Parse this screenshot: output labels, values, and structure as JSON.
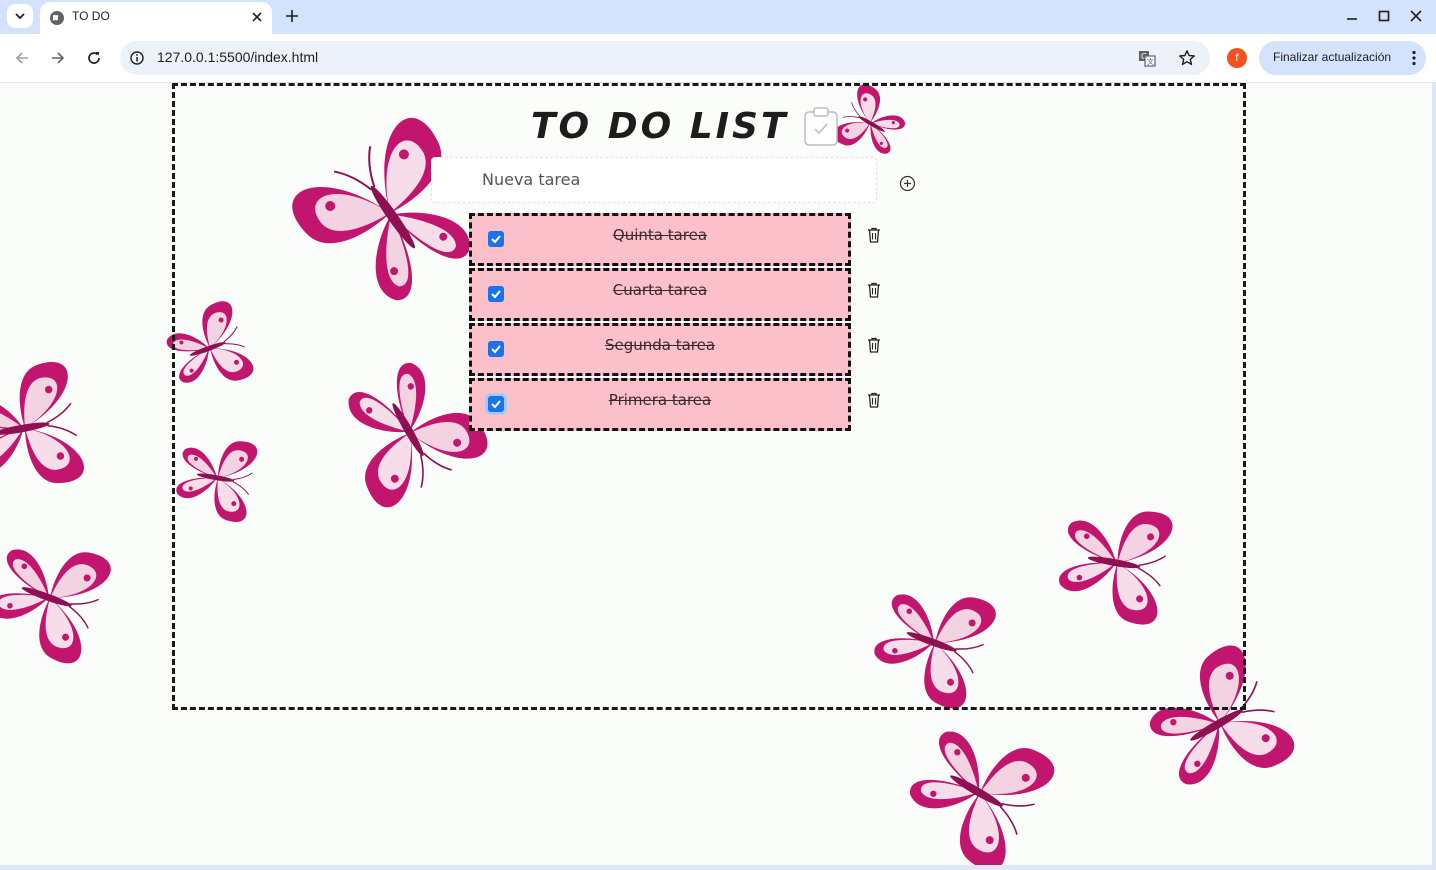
{
  "browser": {
    "tab_title": "TO DO",
    "url": "127.0.0.1:5500/index.html",
    "update_button": "Finalizar actualización",
    "profile_initial": "f"
  },
  "page": {
    "title": "TO DO LIST",
    "new_task_placeholder": "Nueva tarea",
    "tasks": [
      {
        "text": "Quinta tarea",
        "checked": true
      },
      {
        "text": "Cuarta tarea",
        "checked": true
      },
      {
        "text": "Segunda tarea",
        "checked": true
      },
      {
        "text": "Primera tarea",
        "checked": true
      }
    ]
  },
  "colors": {
    "task_bg": "#fcc0cb",
    "butterfly": "#c2166e",
    "checkbox": "#1a73e8"
  },
  "icons": [
    "globe-icon",
    "close-icon",
    "plus-icon",
    "back-icon",
    "forward-icon",
    "reload-icon",
    "info-icon",
    "translate-icon",
    "star-icon",
    "more-vert-icon",
    "clipboard-check-icon",
    "add-circle-icon",
    "trash-icon",
    "butterfly-icon"
  ]
}
